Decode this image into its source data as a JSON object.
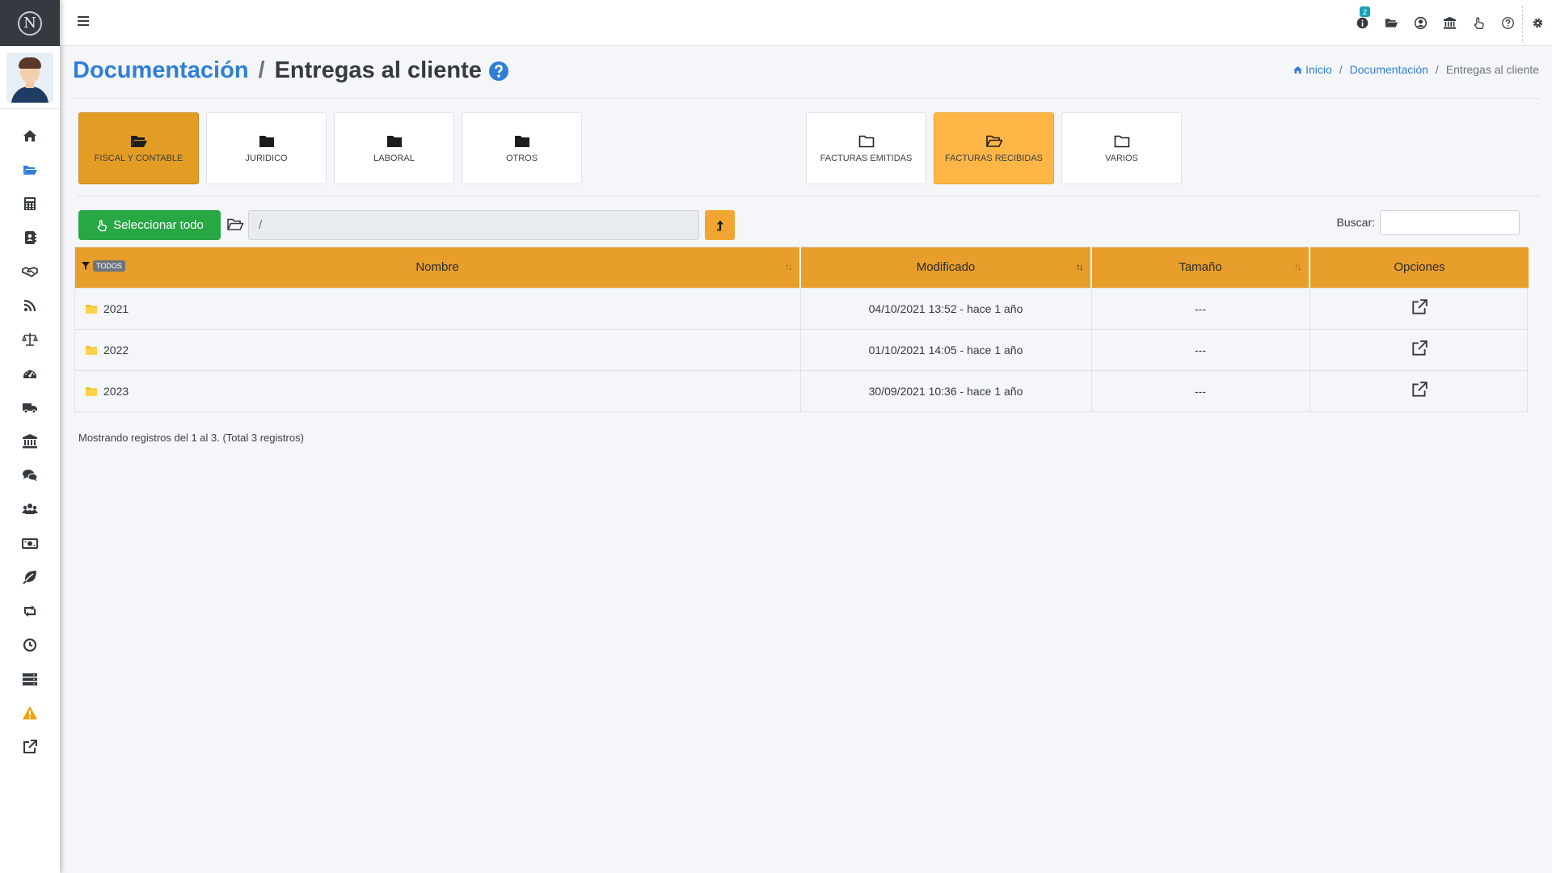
{
  "brand": {
    "logo_letter": "N"
  },
  "sidebar": {
    "items": [
      {
        "icon": "home-icon"
      },
      {
        "icon": "folder-open-icon",
        "active": true
      },
      {
        "icon": "calculator-icon"
      },
      {
        "icon": "address-book-icon"
      },
      {
        "icon": "handshake-icon"
      },
      {
        "icon": "rss-icon"
      },
      {
        "icon": "balance-scale-icon"
      },
      {
        "icon": "dashboard-gauge-icon"
      },
      {
        "icon": "truck-icon"
      },
      {
        "icon": "bank-icon"
      },
      {
        "icon": "comments-icon"
      },
      {
        "icon": "users-icon"
      },
      {
        "icon": "money-bill-icon"
      },
      {
        "icon": "leaf-icon"
      },
      {
        "icon": "retweet-icon"
      },
      {
        "icon": "clock-icon"
      },
      {
        "icon": "server-icon"
      },
      {
        "icon": "warning-icon"
      },
      {
        "icon": "external-link-icon"
      }
    ]
  },
  "topbar": {
    "notification_count": "2",
    "icons": [
      "info-icon",
      "folder-open-icon",
      "user-circle-icon",
      "bank-icon",
      "hand-pointer-icon",
      "question-circle-icon",
      "gear-icon"
    ]
  },
  "header": {
    "title_link": "Documentación",
    "title_sep": "/",
    "title_current": "Entregas al cliente"
  },
  "breadcrumb": {
    "home": "Inicio",
    "sep": "/",
    "section": "Documentación",
    "current": "Entregas al cliente"
  },
  "tiles": {
    "fiscal": "FISCAL Y CONTABLE",
    "juridico": "JURIDICO",
    "laboral": "LABORAL",
    "otros": "OTROS",
    "emitidas": "FACTURAS EMITIDAS",
    "recibidas": "FACTURAS RECIBIDAS",
    "varios": "VARIOS"
  },
  "toolbar": {
    "select_all_label": "Seleccionar todo",
    "path_value": "/",
    "search_label": "Buscar:"
  },
  "table": {
    "filter_badge": "TODOS",
    "columns": {
      "name": "Nombre",
      "modified": "Modificado",
      "size": "Tamaño",
      "options": "Opciones"
    },
    "rows": [
      {
        "name": "2021",
        "modified": "04/10/2021 13:52 - hace 1 año",
        "size": "---"
      },
      {
        "name": "2022",
        "modified": "01/10/2021 14:05 - hace 1 año",
        "size": "---"
      },
      {
        "name": "2023",
        "modified": "30/09/2021 10:36 - hace 1 año",
        "size": "---"
      }
    ]
  },
  "footer": {
    "info": "Mostrando registros del 1 al 3. (Total 3 registros)"
  },
  "colors": {
    "accent_orange": "#e79e2a",
    "tile_active_dark": "#e49d24",
    "tile_active_light": "#ffb646",
    "success_green": "#28a745",
    "link_blue": "#2f7fd6",
    "brand_dark": "#343a40"
  }
}
